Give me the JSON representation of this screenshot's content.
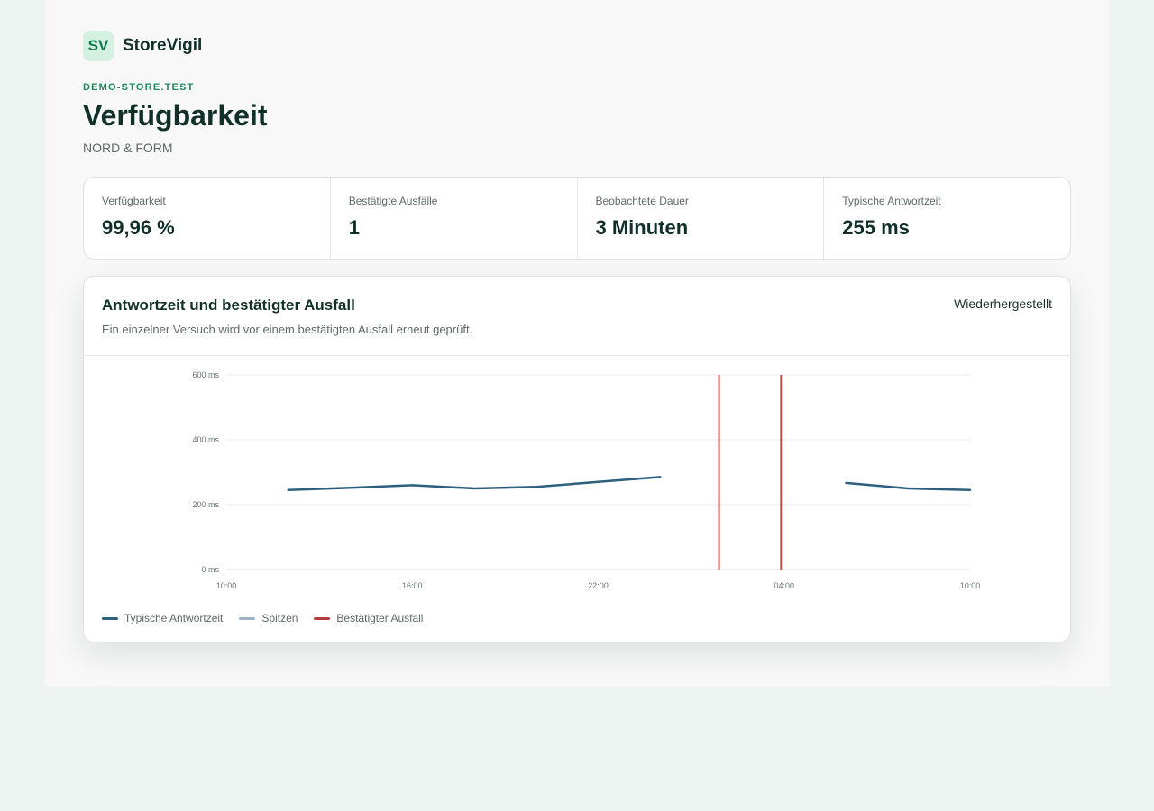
{
  "brand": {
    "logo_text": "SV",
    "name": "StoreVigil"
  },
  "store": {
    "domain": "DEMO-STORE.TEST",
    "title": "Verfügbarkeit",
    "subtitle": "NORD & FORM"
  },
  "stats": [
    {
      "label": "Verfügbarkeit",
      "value": "99,96 %"
    },
    {
      "label": "Bestätigte Ausfälle",
      "value": "1"
    },
    {
      "label": "Beobachtete Dauer",
      "value": "3 Minuten"
    },
    {
      "label": "Typische Antwortzeit",
      "value": "255 ms"
    }
  ],
  "card": {
    "title": "Antwortzeit und bestätigter Ausfall",
    "description": "Ein einzelner Versuch wird vor einem bestätigten Ausfall erneut geprüft.",
    "status": "Wiederhergestellt"
  },
  "legend": [
    {
      "label": "Typische Antwortzeit",
      "color": "#2d5f7e"
    },
    {
      "label": "Spitzen",
      "color": "#9fb3c4"
    },
    {
      "label": "Bestätigter Ausfall",
      "color": "#b73a3a"
    }
  ],
  "chart_data": {
    "type": "line",
    "x_unit": "hours",
    "x_range": [
      10,
      34
    ],
    "x_ticks": [
      {
        "value": 10,
        "label": "10:00"
      },
      {
        "value": 16,
        "label": "16:00"
      },
      {
        "value": 22,
        "label": "22:00"
      },
      {
        "value": 28,
        "label": "04:00"
      },
      {
        "value": 34,
        "label": "10:00"
      }
    ],
    "ylim": [
      0,
      600
    ],
    "y_ticks": [
      {
        "value": 0,
        "label": "0 ms"
      },
      {
        "value": 200,
        "label": "200 ms"
      },
      {
        "value": 400,
        "label": "400 ms"
      },
      {
        "value": 600,
        "label": "600 ms"
      }
    ],
    "grid": true,
    "series": [
      {
        "name": "Typische Antwortzeit",
        "color": "#2d5f7e",
        "segments": [
          [
            {
              "x": 12,
              "y": 245
            },
            {
              "x": 14,
              "y": 252
            },
            {
              "x": 16,
              "y": 260
            },
            {
              "x": 18,
              "y": 250
            },
            {
              "x": 20,
              "y": 255
            },
            {
              "x": 22,
              "y": 270
            },
            {
              "x": 24,
              "y": 285
            }
          ],
          [
            {
              "x": 30,
              "y": 267
            },
            {
              "x": 32,
              "y": 250
            },
            {
              "x": 34,
              "y": 245
            }
          ]
        ]
      }
    ],
    "outages": [
      {
        "x": 25.9,
        "color": "#c94a4a"
      },
      {
        "x": 27.9,
        "color": "#c94a4a"
      }
    ]
  }
}
